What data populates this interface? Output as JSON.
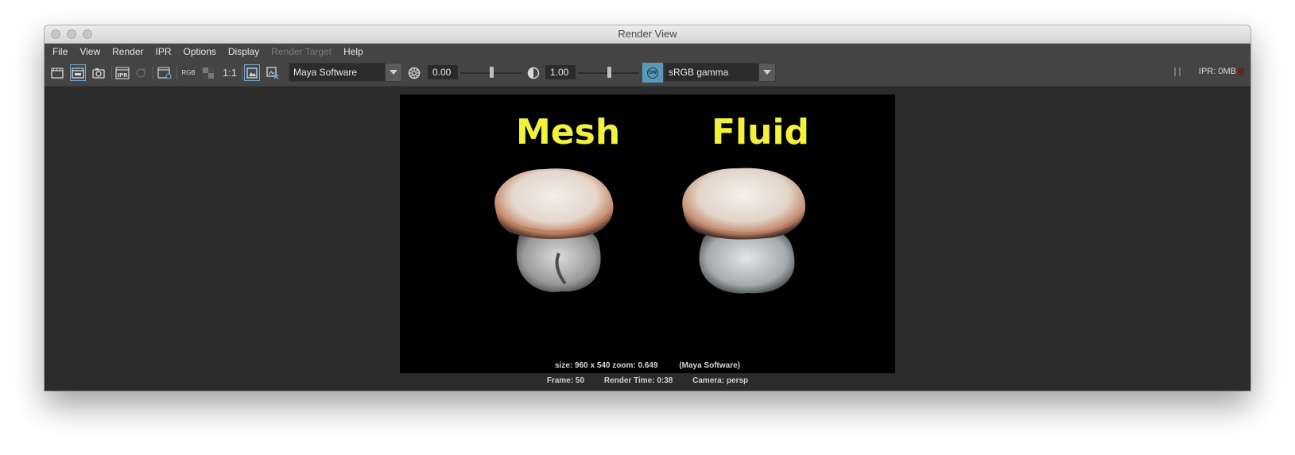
{
  "window": {
    "title": "Render View"
  },
  "menubar": {
    "items": [
      {
        "label": "File",
        "enabled": true
      },
      {
        "label": "View",
        "enabled": true
      },
      {
        "label": "Render",
        "enabled": true
      },
      {
        "label": "IPR",
        "enabled": true
      },
      {
        "label": "Options",
        "enabled": true
      },
      {
        "label": "Display",
        "enabled": true
      },
      {
        "label": "Render Target",
        "enabled": false
      },
      {
        "label": "Help",
        "enabled": true
      }
    ]
  },
  "toolbar": {
    "rgb_label": "RGB",
    "ratio_label": "1:1",
    "ipr_icon_label": "IPR",
    "renderer": "Maya Software",
    "exposure": "0.00",
    "gamma": "1.00",
    "color_management_toggle": "ON",
    "view_transform": "sRGB gamma",
    "ipr_memory": "IPR: 0MB",
    "exposure_slider_fraction": 0.5,
    "gamma_slider_fraction": 0.5
  },
  "render": {
    "label_left": "Mesh",
    "label_right": "Fluid",
    "size_info": "size: 960 x 540 zoom: 0.649",
    "renderer_info": "(Maya Software)",
    "frame": "Frame: 50",
    "render_time": "Render Time: 0:38",
    "camera": "Camera: persp"
  },
  "colors": {
    "label_yellow": "#f2f23a",
    "cm_toggle_blue": "#5c98b8",
    "panel": "#444444",
    "background": "#2b2b2b"
  }
}
